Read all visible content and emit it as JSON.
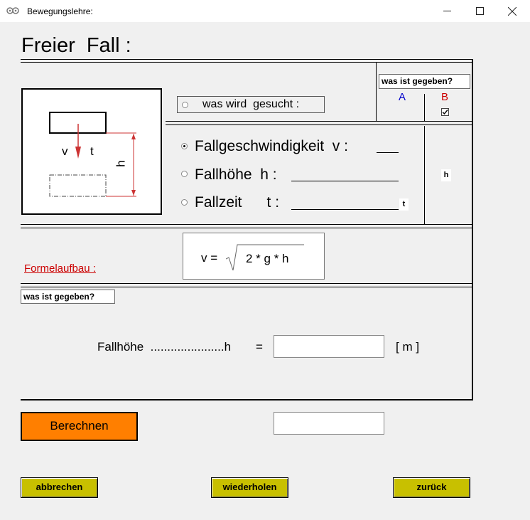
{
  "window": {
    "title": "Bewegungslehre:",
    "minimize": "—",
    "maximize": "☐",
    "close": "✕"
  },
  "heading": "Freier  Fall :",
  "search": {
    "label": "was wird  gesucht :"
  },
  "given": {
    "label": "was ist gegeben?",
    "col_a": "A",
    "col_b": "B",
    "col_b_checked": true,
    "h_badge": "h",
    "t_badge": "t"
  },
  "diagram": {
    "v": "v",
    "t": "t",
    "h": "h"
  },
  "options": [
    {
      "label": "Fallgeschwindigkeit  v :",
      "selected": true
    },
    {
      "label": "Fallhöhe  h :",
      "selected": false
    },
    {
      "label": "Fallzeit      t :",
      "selected": false
    }
  ],
  "formula": {
    "label": "Formelaufbau :",
    "lhs": "v =",
    "radicand": "2 * g * h"
  },
  "given_section": {
    "label": "was ist gegeben?",
    "field_label": "Fallhöhe  ......................h",
    "equals": "=",
    "unit": "[ m ]",
    "value": ""
  },
  "actions": {
    "calculate": "Berechnen",
    "result": "",
    "cancel": "abbrechen",
    "repeat": "wiederholen",
    "back": "zurück"
  },
  "colors": {
    "accent_red": "#cc0000",
    "accent_blue": "#0000cc",
    "calc_button": "#ff7f00",
    "nav_button": "#c8c000"
  }
}
